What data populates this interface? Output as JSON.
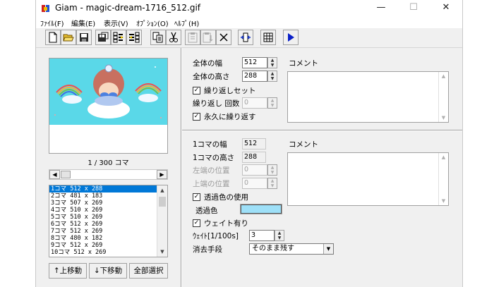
{
  "window": {
    "title": "Giam - magic-dream-1716_512.gif",
    "minimize": "—",
    "maximize": "☐",
    "close": "✕"
  },
  "menu": [
    "ﾌｧｲﾙ(F)",
    "編集(E)",
    "表示(V)",
    "ｵﾌﾟｼｮﾝ(O)",
    "ﾍﾙﾌﾟ(H)"
  ],
  "toolbar": {
    "icons": [
      "new-file-icon",
      "open-folder-icon",
      "save-icon",
      "save-as-icon",
      "insert-frames-icon",
      "add-frames-icon",
      "copy-icon",
      "cut-icon",
      "paste-icon",
      "paste-insert-icon",
      "delete-icon",
      "fit-width-icon",
      "grid-icon",
      "play-icon"
    ],
    "colors": {
      "folder": "#e8c030",
      "play": "#0a20c8",
      "disk": "#2c2c2c",
      "disabled": "#a8a8a8"
    }
  },
  "preview": {
    "frame_counter": "1 / 300 コマ",
    "background": "#5ad8e8"
  },
  "frame_list": {
    "rows": [
      "1コマ 512 x 288",
      "2コマ 481 x 183",
      "3コマ 507 x 269",
      "4コマ 510 x 269",
      "5コマ 510 x 269",
      "6コマ 512 x 269",
      "7コマ 512 x 269",
      "8コマ 480 x 182",
      "9コマ 512 x 269",
      "10コマ 512 x 269"
    ],
    "selected_index": 0,
    "selection_color": "#0078d7"
  },
  "buttons": {
    "move_up": "↑上移動",
    "move_down": "↓下移動",
    "select_all": "全部選択"
  },
  "global": {
    "width_label": "全体の幅",
    "width_value": "512",
    "height_label": "全体の高さ",
    "height_value": "288",
    "loop_set_label": "繰り返しセット",
    "loop_count_label": "繰り返し 回数",
    "loop_count_value": "0",
    "loop_forever_label": "永久に繰り返す",
    "comment_label": "コメント"
  },
  "frame": {
    "width_label": "1コマの幅",
    "width_value": "512",
    "height_label": "1コマの高さ",
    "height_value": "288",
    "left_label": "左端の位置",
    "left_value": "0",
    "top_label": "上端の位置",
    "top_value": "0",
    "transparent_label": "透過色の使用",
    "transparent_color_label": "透過色",
    "transparent_color": "#9ee0f8",
    "wait_enabled_label": "ウェイト有り",
    "wait_label": "ｳｪｲﾄ[1/100s]",
    "wait_value": "3",
    "dispose_label": "消去手段",
    "dispose_value": "そのまま残す",
    "comment_label": "コメント",
    "check_mark": "✓"
  }
}
